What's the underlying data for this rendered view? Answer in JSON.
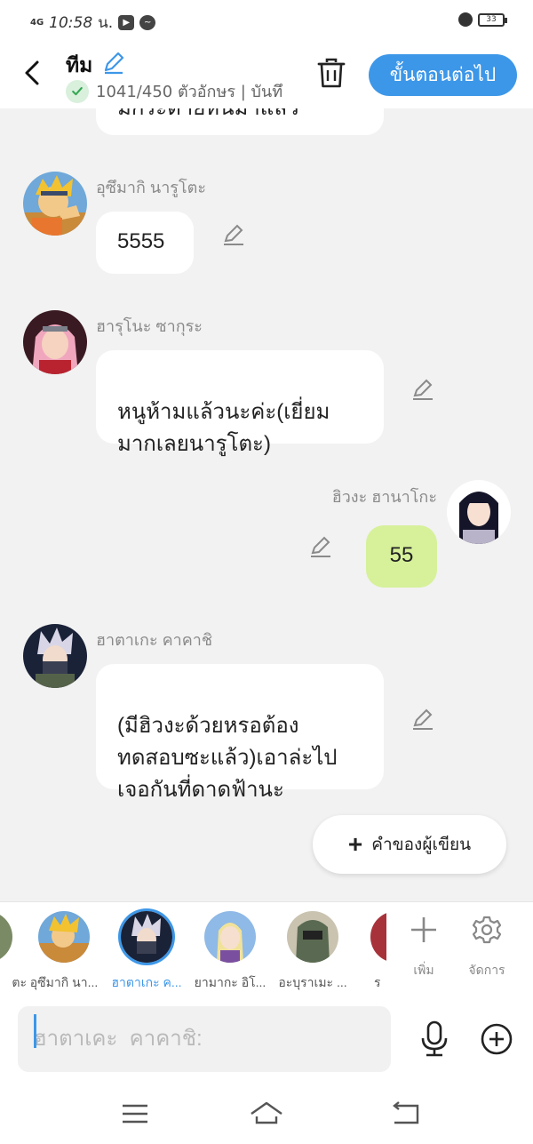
{
  "status_bar": {
    "network": "4G",
    "time": "10:58",
    "meridiem": "น.",
    "battery": "33"
  },
  "header": {
    "title": "ทีม",
    "char_count": "1041/450 ตัวอักษร | บันทึ",
    "next_label": "ขั้นตอนต่อไป",
    "accent": "#3d97e8"
  },
  "chat": {
    "messages": [
      {
        "id": "m0",
        "sender": "",
        "text": "มีกระต่ายหนีมาแล้ว",
        "side": "left"
      },
      {
        "id": "m1",
        "sender": "อุซึมากิ นารูโตะ",
        "text": "5555",
        "side": "left"
      },
      {
        "id": "m2",
        "sender": "ฮารุโนะ ซากุระ",
        "text": "หนูห้ามแล้วนะค่ะ(เยี่ยม\nมากเลยนารูโตะ)",
        "side": "left"
      },
      {
        "id": "m3",
        "sender": "ฮิวงะ ฮานาโกะ",
        "text": "55",
        "side": "right"
      },
      {
        "id": "m4",
        "sender": "ฮาตาเกะ คาคาชิ",
        "text": "(มีฮิวงะด้วยหรอต้อง\nทดสอบซะแล้ว)เอาล่ะไป\nเจอกันที่ดาดฟ้านะ",
        "side": "left"
      }
    ],
    "write_button": "คำของผู้เขียน",
    "bubble_green": "#d6f19a"
  },
  "characters": [
    {
      "label": "ตะ",
      "selected": false
    },
    {
      "label": "อุซึมากิ นา...",
      "selected": false
    },
    {
      "label": "ฮาตาเกะ ค...",
      "selected": true
    },
    {
      "label": "ยามากะ อิโ...",
      "selected": false
    },
    {
      "label": "อะบุราเมะ ...",
      "selected": false
    },
    {
      "label": "ร",
      "selected": false
    }
  ],
  "tools": {
    "add_label": "เพิ่ม",
    "manage_label": "จัดการ"
  },
  "input": {
    "placeholder": "ฮาตาเคะ  คาคาชิ:"
  }
}
